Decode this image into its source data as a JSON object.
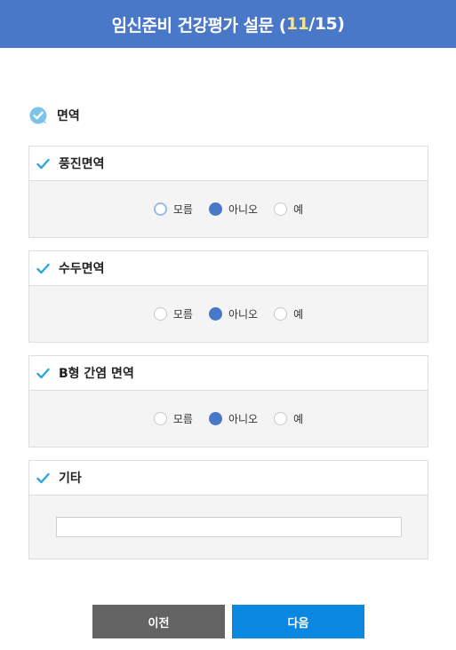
{
  "header": {
    "title_prefix": "임신준비 건강평가 설문 (",
    "current": "11",
    "title_suffix": "/15)"
  },
  "section": {
    "title": "면역"
  },
  "questions": [
    {
      "title": "풍진면역",
      "options": [
        "모름",
        "아니오",
        "예"
      ],
      "selected": "아니오"
    },
    {
      "title": "수두면역",
      "options": [
        "모름",
        "아니오",
        "예"
      ],
      "selected": "아니오"
    },
    {
      "title": "B형 간염 면역",
      "options": [
        "모름",
        "아니오",
        "예"
      ],
      "selected": "아니오"
    }
  ],
  "other": {
    "title": "기타",
    "value": ""
  },
  "buttons": {
    "prev": "이전",
    "next": "다음"
  },
  "colors": {
    "header_bg": "#4a78c9",
    "check": "#2fa6dc",
    "radio_selected": "#4a78c9",
    "prev_bg": "#636363",
    "next_bg": "#0a87e1"
  }
}
